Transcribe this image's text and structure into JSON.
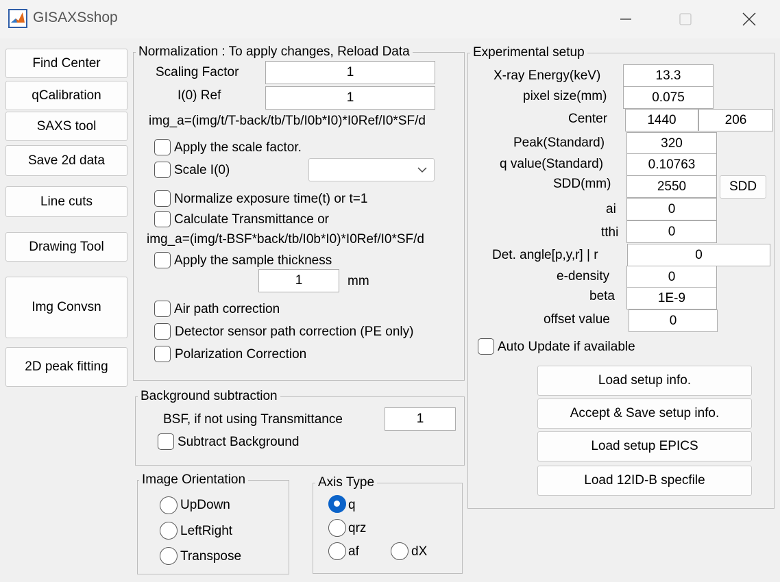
{
  "window": {
    "title": "GISAXSshop"
  },
  "sidebar": {
    "buttons": [
      "Find Center",
      "qCalibration",
      "SAXS tool",
      "Save 2d data",
      "Line cuts",
      "Drawing Tool",
      "Img Convsn",
      "2D peak fitting"
    ]
  },
  "normalization": {
    "title": "Normalization : To apply changes, Reload Data",
    "scaling_factor_label": "Scaling Factor",
    "scaling_factor_value": "1",
    "i0ref_label": "I(0) Ref",
    "i0ref_value": "1",
    "formula1": "img_a=(img/t/T-back/tb/Tb/I0b*I0)*I0Ref/I0*SF/d",
    "apply_scale_label": "Apply the scale factor.",
    "scale_i0_label": "Scale I(0)",
    "scale_i0_selected": "",
    "normalize_exposure_label": "Normalize exposure time(t) or t=1",
    "calc_transmittance_label": "Calculate Transmittance or",
    "formula2": "img_a=(img/t-BSF*back/tb/I0b*I0)*I0Ref/I0*SF/d",
    "apply_thickness_label": "Apply the sample thickness",
    "thickness_value": "1",
    "thickness_unit": "mm",
    "air_path_label": "Air path correction",
    "detector_sensor_label": "Detector sensor path correction (PE only)",
    "polarization_label": "Polarization Correction"
  },
  "background": {
    "title": "Background subtraction",
    "bsf_label": "BSF, if not using Transmittance",
    "bsf_value": "1",
    "subtract_label": "Subtract Background"
  },
  "orientation": {
    "title": "Image Orientation",
    "options": [
      "UpDown",
      "LeftRight",
      "Transpose"
    ]
  },
  "axis": {
    "title": "Axis Type",
    "options": [
      "q",
      "qrz",
      "af",
      "dX"
    ],
    "selected": "q"
  },
  "setup": {
    "title": "Experimental setup",
    "xray_energy_label": "X-ray Energy(keV)",
    "xray_energy_value": "13.3",
    "pixel_size_label": "pixel size(mm)",
    "pixel_size_value": "0.075",
    "center_label": "Center",
    "center_x": "1440",
    "center_y": "206",
    "peak_label": "Peak(Standard)",
    "peak_value": "320",
    "qvalue_label": "q value(Standard)",
    "qvalue_value": "0.10763",
    "sdd_label": "SDD(mm)",
    "sdd_value": "2550",
    "sdd_button": "SDD",
    "ai_label": "ai",
    "ai_value": "0",
    "tthi_label": "tthi",
    "tthi_value": "0",
    "det_angle_label": "Det. angle[p,y,r] | r",
    "det_angle_value": "0",
    "edensity_label": "e-density",
    "edensity_value": "0",
    "beta_label": "beta",
    "beta_value": "1E-9",
    "offset_label": "offset value",
    "offset_value": "0",
    "auto_update_label": "Auto Update if available",
    "buttons": [
      "Load setup info.",
      "Accept & Save setup info.",
      "Load setup EPICS",
      "Load 12ID-B specfile"
    ]
  }
}
